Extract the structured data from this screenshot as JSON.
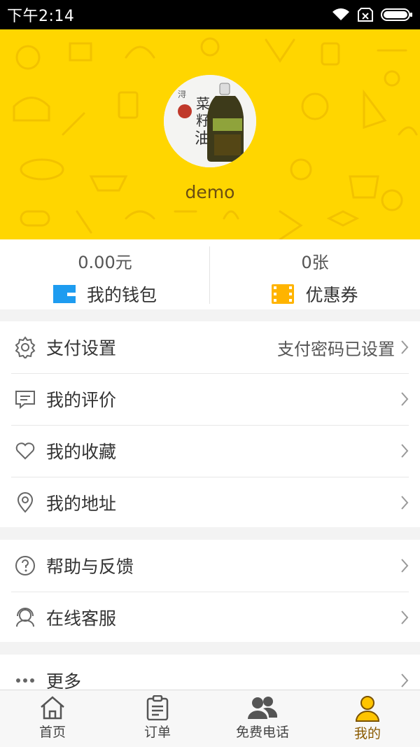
{
  "status_bar": {
    "time": "下午2:14"
  },
  "profile": {
    "username": "demo"
  },
  "wallet": {
    "balance_value": "0.00元",
    "balance_label": "我的钱包",
    "coupon_value": "0张",
    "coupon_label": "优惠券"
  },
  "menu_section1": [
    {
      "label": "支付设置",
      "value": "支付密码已设置",
      "icon": "gear-icon"
    },
    {
      "label": "我的评价",
      "value": "",
      "icon": "comment-icon"
    },
    {
      "label": "我的收藏",
      "value": "",
      "icon": "heart-icon"
    },
    {
      "label": "我的地址",
      "value": "",
      "icon": "location-pin-icon"
    }
  ],
  "menu_section2": [
    {
      "label": "帮助与反馈",
      "icon": "help-icon"
    },
    {
      "label": "在线客服",
      "icon": "headset-icon"
    }
  ],
  "menu_section3": [
    {
      "label": "更多",
      "icon": "more-dots-icon"
    }
  ],
  "bottom_nav": [
    {
      "label": "首页",
      "icon": "home-icon"
    },
    {
      "label": "订单",
      "icon": "clipboard-icon"
    },
    {
      "label": "免费电话",
      "icon": "people-icon"
    },
    {
      "label": "我的",
      "icon": "user-icon",
      "active": true
    }
  ],
  "colors": {
    "header_bg": "#ffd600",
    "wallet_icon": "#1e9cf0",
    "coupon_icon": "#ffb400",
    "active_nav": "#ffc400"
  }
}
